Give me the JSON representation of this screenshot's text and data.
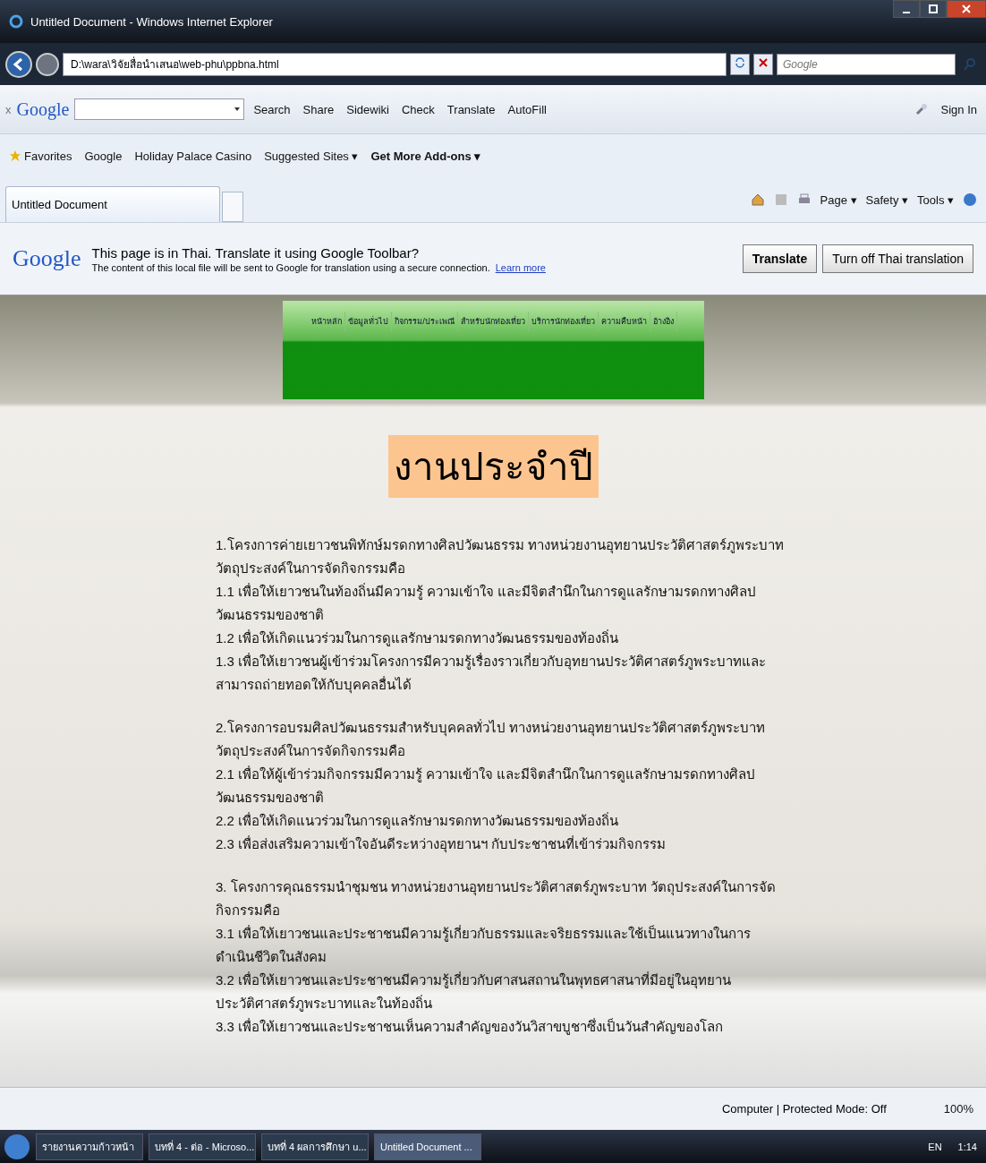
{
  "window": {
    "title": "Untitled Document - Windows Internet Explorer"
  },
  "address_bar": {
    "url": "D:\\wara\\วิจัยสื่อนำเสนอ\\web-phu\\ppbna.html"
  },
  "search_box": {
    "placeholder": "Google"
  },
  "google_toolbar": {
    "logo": "Google",
    "close": "x",
    "items": [
      {
        "label": "Search"
      },
      {
        "label": "Share"
      },
      {
        "label": "Sidewiki"
      },
      {
        "label": "Check"
      },
      {
        "label": "Translate"
      },
      {
        "label": "AutoFill"
      }
    ],
    "sign_in": "Sign In"
  },
  "favorites_bar": {
    "label": "Favorites",
    "links": [
      {
        "label": "Google",
        "bold": false
      },
      {
        "label": "Holiday Palace Casino",
        "bold": false
      },
      {
        "label": "Suggested Sites ▾",
        "bold": false
      },
      {
        "label": "Get More Add-ons ▾",
        "bold": true
      }
    ]
  },
  "tabs": [
    {
      "label": "Untitled Document",
      "selected": true
    }
  ],
  "command_bar": [
    "Page ▾",
    "Safety ▾",
    "Tools ▾"
  ],
  "translate_bar": {
    "logo": "Google",
    "message": "This page is in Thai.  Translate it using Google Toolbar?",
    "detail": "The content of this local file will be sent to Google for translation using a secure connection.",
    "link": "Learn more",
    "buttons": [
      "Translate",
      "Turn off Thai translation"
    ]
  },
  "page": {
    "nav": [
      "หน้าหลัก",
      "ข้อมูลทั่วไป",
      "กิจกรรม/ประเพณี",
      "สำหรับนักท่องเที่ยว",
      "บริการนักท่องเที่ยว",
      "ความคืบหน้า",
      "อ้างอิง"
    ],
    "heading": "งานประจำปี",
    "sections": [
      {
        "lines": [
          "1.โครงการค่ายเยาวชนพิทักษ์มรดกทางศิลปวัฒนธรรม ทางหน่วยงานอุทยานประวัติศาสตร์ภูพระบาท วัตถุประสงค์ในการจัดกิจกรรมคือ",
          "1.1  เพื่อให้เยาวชนในท้องถิ่นมีความรู้ ความเข้าใจ และมีจิตสำนึกในการดูแลรักษามรดกทางศิลปวัฒนธรรมของชาติ",
          "1.2  เพื่อให้เกิดแนวร่วมในการดูแลรักษามรดกทางวัฒนธรรมของท้องถิ่น",
          "1.3  เพื่อให้เยาวชนผู้เข้าร่วมโครงการมีความรู้เรื่องราวเกี่ยวกับอุทยานประวัติศาสตร์ภูพระบาทและสามารถถ่ายทอดให้กับบุคคลอื่นได้"
        ]
      },
      {
        "lines": [
          "2.โครงการอบรมศิลปวัฒนธรรมสำหรับบุคคลทั่วไป ทางหน่วยงานอุทยานประวัติศาสตร์ภูพระบาท  วัตถุประสงค์ในการจัดกิจกรรมคือ",
          "2.1 เพื่อให้ผู้เข้าร่วมกิจกรรมมีความรู้  ความเข้าใจ  และมีจิตสำนึกในการดูแลรักษามรดกทางศิลปวัฒนธรรมของชาติ",
          "2.2 เพื่อให้เกิดแนวร่วมในการดูแลรักษามรดกทางวัฒนธรรมของท้องถิ่น",
          "2.3 เพื่อส่งเสริมความเข้าใจอันดีระหว่างอุทยานฯ กับประชาชนที่เข้าร่วมกิจกรรม"
        ]
      },
      {
        "lines": [
          "3. โครงการคุณธรรมนำชุมชน ทางหน่วยงานอุทยานประวัติศาสตร์ภูพระบาท  วัตถุประสงค์ในการจัดกิจกรรมคือ",
          "3.1  เพื่อให้เยาวชนและประชาชนมีความรู้เกี่ยวกับธรรมและจริยธรรมและใช้เป็นแนวทางในการดำเนินชีวิตในสังคม",
          "3.2 เพื่อให้เยาวชนและประชาชนมีความรู้เกี่ยวกับศาสนสถานในพุทธศาสนาที่มีอยู่ในอุทยานประวัติศาสตร์ภูพระบาทและในท้องถิ่น",
          "3.3  เพื่อให้เยาวชนและประชาชนเห็นความสำคัญของวันวิสาขบูชาซึ่งเป็นวันสำคัญของโลก"
        ]
      }
    ]
  },
  "status_bar": {
    "zone": "Computer | Protected Mode: Off",
    "zoom": "100%"
  },
  "taskbar": {
    "buttons": [
      {
        "label": "รายงานความก้าวหน้า",
        "selected": false
      },
      {
        "label": "บทที่ 4 - ต่อ - Microso...",
        "selected": false
      },
      {
        "label": "บทที่ 4  ผลการศึกษา u...",
        "selected": false
      },
      {
        "label": "Untitled Document ...",
        "selected": true
      }
    ],
    "language": "EN",
    "time": "1:14"
  }
}
